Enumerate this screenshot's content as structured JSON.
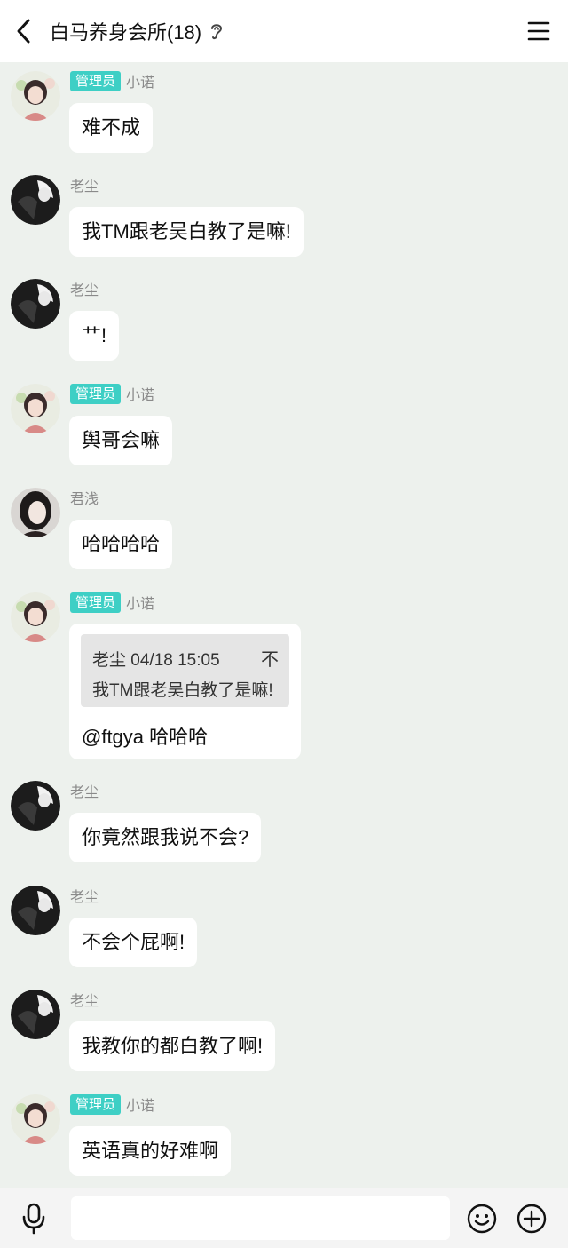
{
  "header": {
    "title": "白马养身会所(18)",
    "back_icon": "chevron-left-icon",
    "ear_icon": "ear-icon",
    "menu_icon": "hamburger-menu-icon"
  },
  "messages": [
    {
      "badge": "管理员",
      "name": "小诺",
      "text": "难不成"
    },
    {
      "badge": "",
      "name": "老尘",
      "text": "我TM跟老吴白教了是嘛!"
    },
    {
      "badge": "",
      "name": "老尘",
      "text": "艹!"
    },
    {
      "badge": "管理员",
      "name": "小诺",
      "text": "舆哥会嘛"
    },
    {
      "badge": "",
      "name": "君浅",
      "text": "哈哈哈哈"
    },
    {
      "badge": "管理员",
      "name": "小诺",
      "quote": {
        "author_time": "老尘 04/18 15:05",
        "close": "不",
        "text": "我TM跟老吴白教了是嘛!"
      },
      "text": "@ftgya 哈哈哈"
    },
    {
      "badge": "",
      "name": "老尘",
      "text": "你竟然跟我说不会?"
    },
    {
      "badge": "",
      "name": "老尘",
      "text": "不会个屁啊!"
    },
    {
      "badge": "",
      "name": "老尘",
      "text": "我教你的都白教了啊!"
    },
    {
      "badge": "管理员",
      "name": "小诺",
      "text": "英语真的好难啊"
    }
  ],
  "input": {
    "value": "",
    "placeholder": ""
  },
  "bottom_icons": {
    "mic": "microphone-icon",
    "emoji": "emoji-icon",
    "plus": "plus-circle-icon"
  },
  "colors": {
    "badge": "#3ecfc5",
    "background": "#edf1ed",
    "bubble": "#ffffff"
  }
}
